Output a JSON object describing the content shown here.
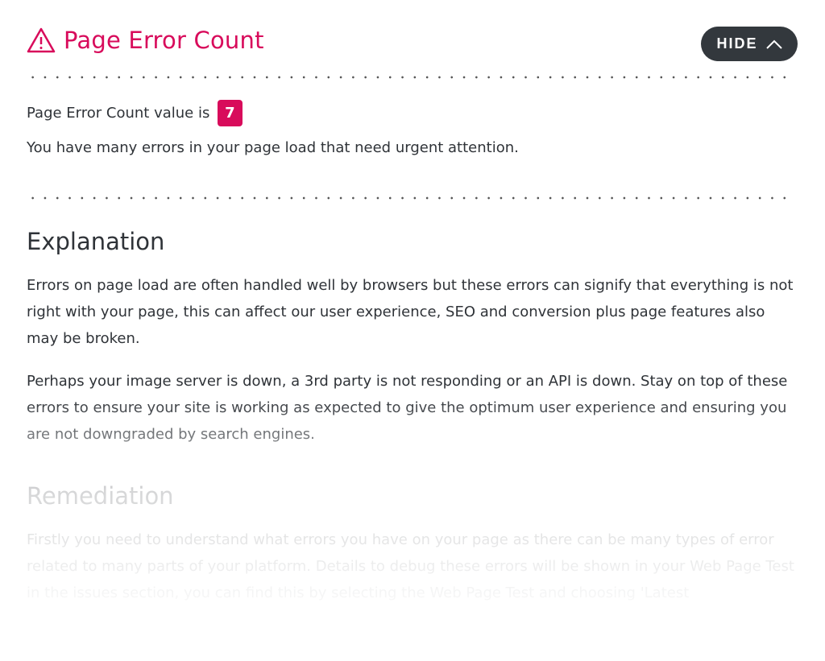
{
  "header": {
    "title": "Page Error Count",
    "icon": "warning-triangle-icon",
    "hide_label": "HIDE"
  },
  "summary": {
    "value_label": "Page Error Count value is",
    "value": "7",
    "message": "You have many errors in your page load that need urgent attention."
  },
  "explanation": {
    "heading": "Explanation",
    "paragraphs": [
      "Errors on page load are often handled well by browsers but these errors can signify that everything is not right with your page, this can affect our user experience, SEO and conversion plus page features also may be broken.",
      "Perhaps your image server is down, a 3rd party is not responding or an API is down. Stay on top of these errors to ensure your site is working as expected to give the optimum user experience and ensuring you are not downgraded by search engines."
    ]
  },
  "remediation": {
    "heading": "Remediation",
    "paragraphs": [
      "Firstly you need to understand what errors you have on your page as there can be many types of error related to many parts of your platform. Details to debug these errors will be shown in your Web Page Test in the issues section, you can find this by selecting the Web Page Test and choosing 'Latest"
    ]
  },
  "colors": {
    "accent": "#d80b5b",
    "button_bg": "#33383d",
    "text": "#2f3338"
  }
}
